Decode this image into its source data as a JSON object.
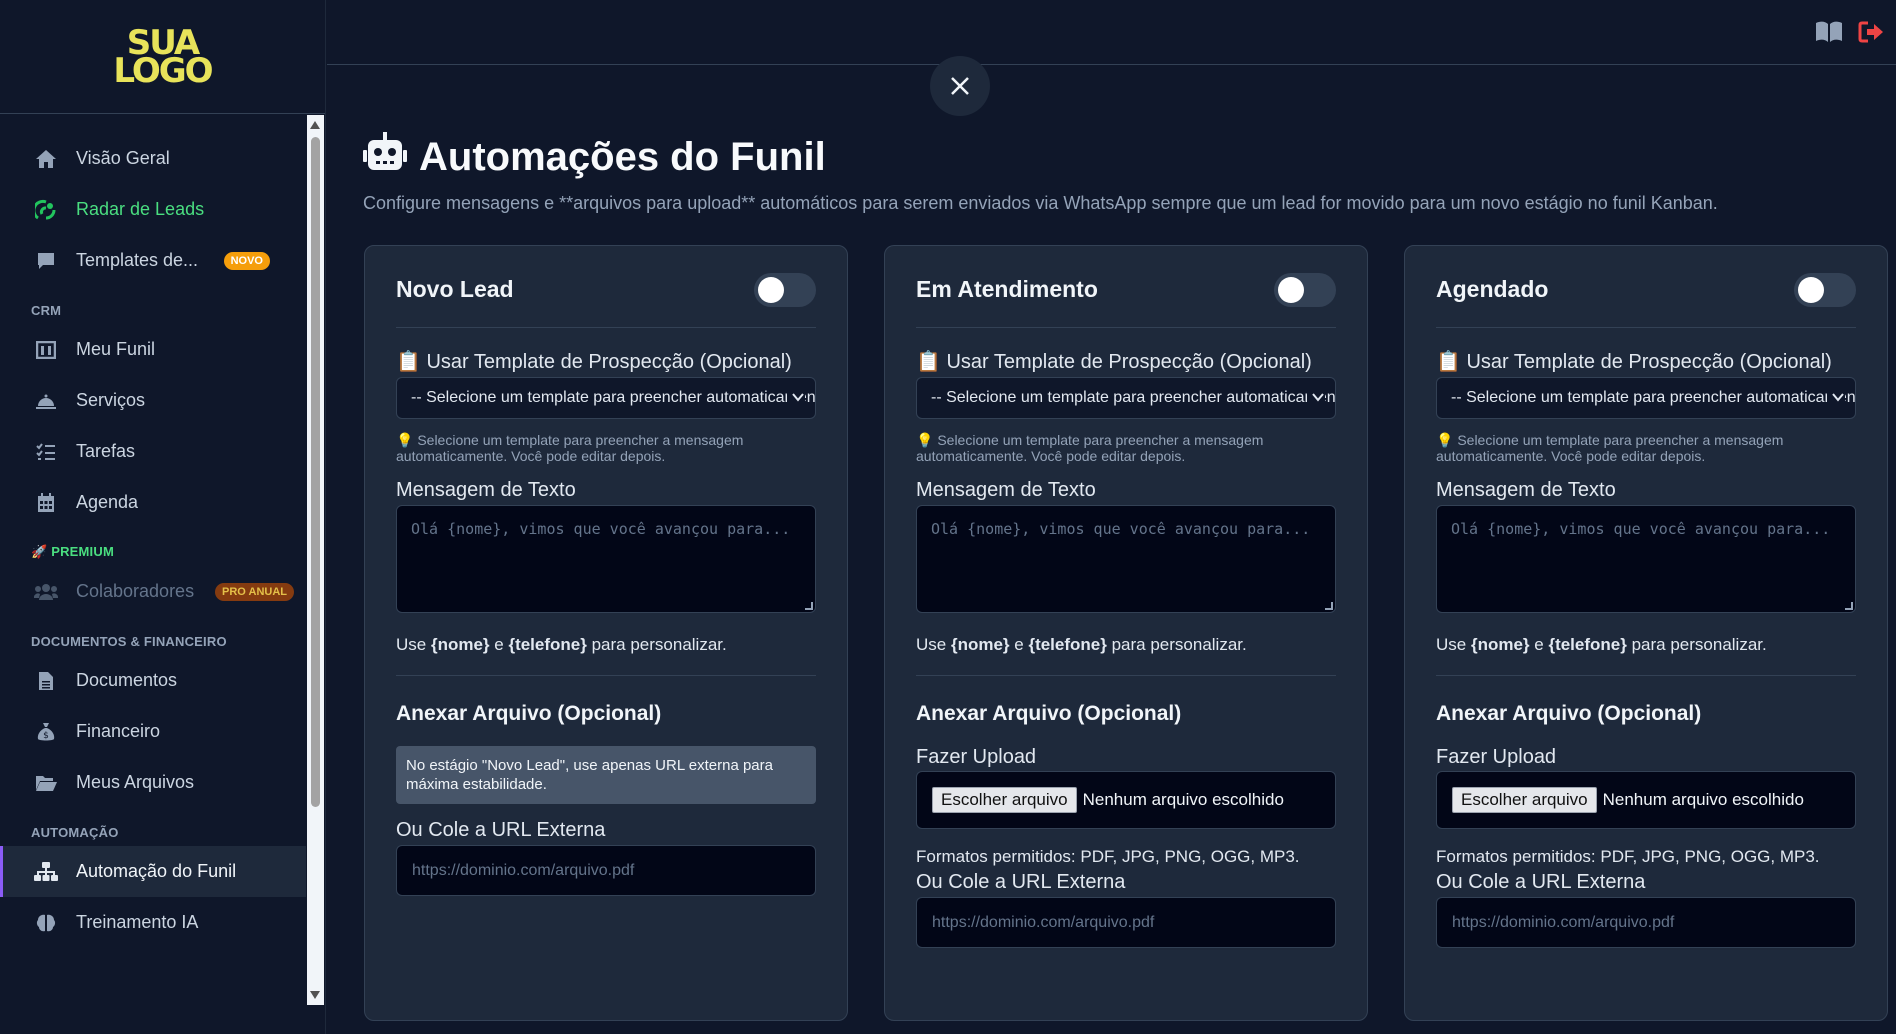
{
  "logo": {
    "line1": "SUA",
    "line2": "LOGO"
  },
  "sidebar": {
    "items": [
      {
        "label": "Visão Geral"
      },
      {
        "label": "Radar de Leads"
      },
      {
        "label": "Templates de...",
        "badge": "NOVO"
      }
    ],
    "sections": {
      "crm": "CRM",
      "premium": "🚀 PREMIUM",
      "docs": "DOCUMENTOS & FINANCEIRO",
      "automation": "AUTOMAÇÃO"
    },
    "crm_items": [
      {
        "label": "Meu Funil"
      },
      {
        "label": "Serviços"
      },
      {
        "label": "Tarefas"
      },
      {
        "label": "Agenda"
      }
    ],
    "premium_items": [
      {
        "label": "Colaboradores",
        "badge": "PRO ANUAL"
      }
    ],
    "docs_items": [
      {
        "label": "Documentos"
      },
      {
        "label": "Financeiro"
      },
      {
        "label": "Meus Arquivos"
      }
    ],
    "automation_items": [
      {
        "label": "Automação do Funil"
      },
      {
        "label": "Treinamento IA"
      }
    ]
  },
  "page": {
    "title": "Automações do Funil",
    "subtitle": "Configure mensagens e **arquivos para upload** automáticos para serem enviados via WhatsApp sempre que um lead for movido para um novo estágio no funil Kanban."
  },
  "common": {
    "template_label": "📋 Usar Template de Prospecção (Opcional)",
    "template_select_value": "-- Selecione um template para preencher automaticamente --",
    "template_hint": "💡 Selecione um template para preencher a mensagem automaticamente. Você pode editar depois.",
    "message_label": "Mensagem de Texto",
    "message_placeholder": "Olá {nome}, vimos que você avançou para...",
    "use_prefix": "Use ",
    "use_nome": "{nome}",
    "use_and": " e ",
    "use_telefone": "{telefone}",
    "use_suffix": " para personalizar.",
    "attach_title": "Anexar Arquivo (Opcional)",
    "upload_label": "Fazer Upload",
    "file_button": "Escolher arquivo",
    "file_none": "Nenhum arquivo escolhido",
    "formats": "Formatos permitidos: PDF, JPG, PNG, OGG, MP3.",
    "url_label": "Ou Cole a URL Externa",
    "url_placeholder": "https://dominio.com/arquivo.pdf"
  },
  "cards": [
    {
      "title": "Novo Lead",
      "enabled": false,
      "info": "No estágio \"Novo Lead\", use apenas URL externa para máxima estabilidade."
    },
    {
      "title": "Em Atendimento",
      "enabled": false
    },
    {
      "title": "Agendado",
      "enabled": false
    }
  ],
  "colors": {
    "accent_green": "#22c55e",
    "logout_red": "#ef4444",
    "active_border": "#8b5cf6",
    "badge_novo": "#f59e0b"
  }
}
